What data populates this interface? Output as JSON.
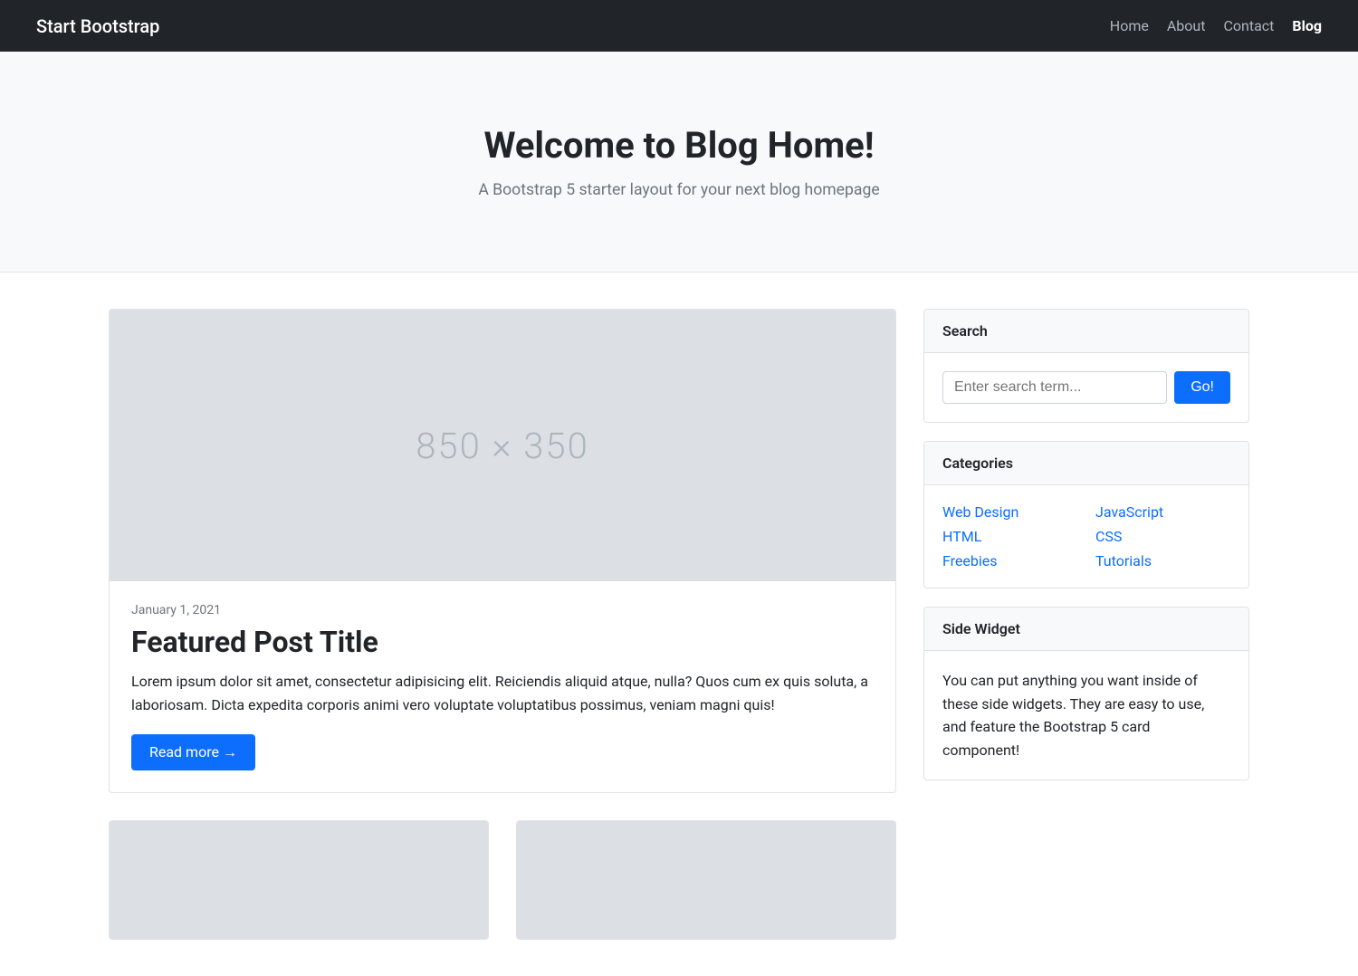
{
  "navbar": {
    "brand": "Start Bootstrap",
    "links": [
      {
        "label": "Home",
        "active": false
      },
      {
        "label": "About",
        "active": false
      },
      {
        "label": "Contact",
        "active": false
      },
      {
        "label": "Blog",
        "active": true
      }
    ]
  },
  "hero": {
    "title": "Welcome to Blog Home!",
    "subtitle": "A Bootstrap 5 starter layout for your next blog homepage"
  },
  "featured_post": {
    "placeholder": "850 × 350",
    "date": "January 1, 2021",
    "title": "Featured Post Title",
    "text": "Lorem ipsum dolor sit amet, consectetur adipisicing elit. Reiciendis aliquid atque, nulla? Quos cum ex quis soluta, a laboriosam. Dicta expedita corporis animi vero voluptate voluptatibus possimus, veniam magni quis!",
    "read_more": "Read more →"
  },
  "sidebar": {
    "search": {
      "header": "Search",
      "placeholder": "Enter search term...",
      "button": "Go!"
    },
    "categories": {
      "header": "Categories",
      "items": [
        {
          "label": "Web Design"
        },
        {
          "label": "JavaScript"
        },
        {
          "label": "HTML"
        },
        {
          "label": "CSS"
        },
        {
          "label": "Freebies"
        },
        {
          "label": "Tutorials"
        }
      ]
    },
    "side_widget": {
      "header": "Side Widget",
      "text": "You can put anything you want inside of these side widgets. They are easy to use, and feature the Bootstrap 5 card component!"
    }
  }
}
